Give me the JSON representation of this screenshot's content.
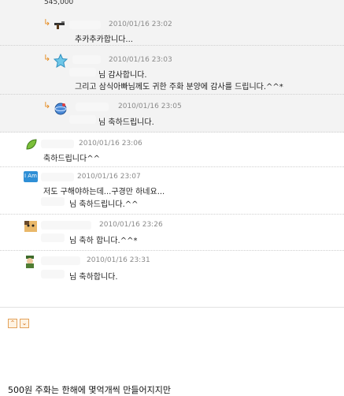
{
  "top": {
    "number": "545,000"
  },
  "comments": [
    {
      "date": "2010/01/16 23:02",
      "lines": [
        "추카추카합니다..."
      ],
      "icon": "gun-icon"
    },
    {
      "date": "2010/01/16 23:03",
      "lines": [
        "님 감사합니다.",
        "그리고 삼식아빠님께도 귀한 주화 분양에 감사를 드립니다.^^*"
      ],
      "icon": "star-icon"
    },
    {
      "date": "2010/01/16 23:05",
      "lines": [
        "님 축하드립니다."
      ],
      "icon": "globe-icon"
    },
    {
      "date": "2010/01/16 23:06",
      "lines": [
        "축하드립니다^^"
      ],
      "icon": "leaf-icon"
    },
    {
      "date": "2010/01/16 23:07",
      "lines": [
        "저도 구해야하는데...구경만 하네요...",
        "님 축하드립니다.^^"
      ],
      "icon": "iam-icon",
      "icon_text": "I Am"
    },
    {
      "date": "2010/01/16 23:26",
      "lines": [
        "님 축하 합니다.^^*"
      ],
      "icon": "cat-icon"
    },
    {
      "date": "2010/01/16 23:31",
      "lines": [
        "님 축하합니다."
      ],
      "icon": "soldier-icon"
    }
  ],
  "reply_arrow": "↳",
  "controls": {
    "up": "⌃",
    "down": "⌄"
  },
  "footer": {
    "text": "500원 주화는 한해에 몇억개씩 만들어지지만"
  }
}
